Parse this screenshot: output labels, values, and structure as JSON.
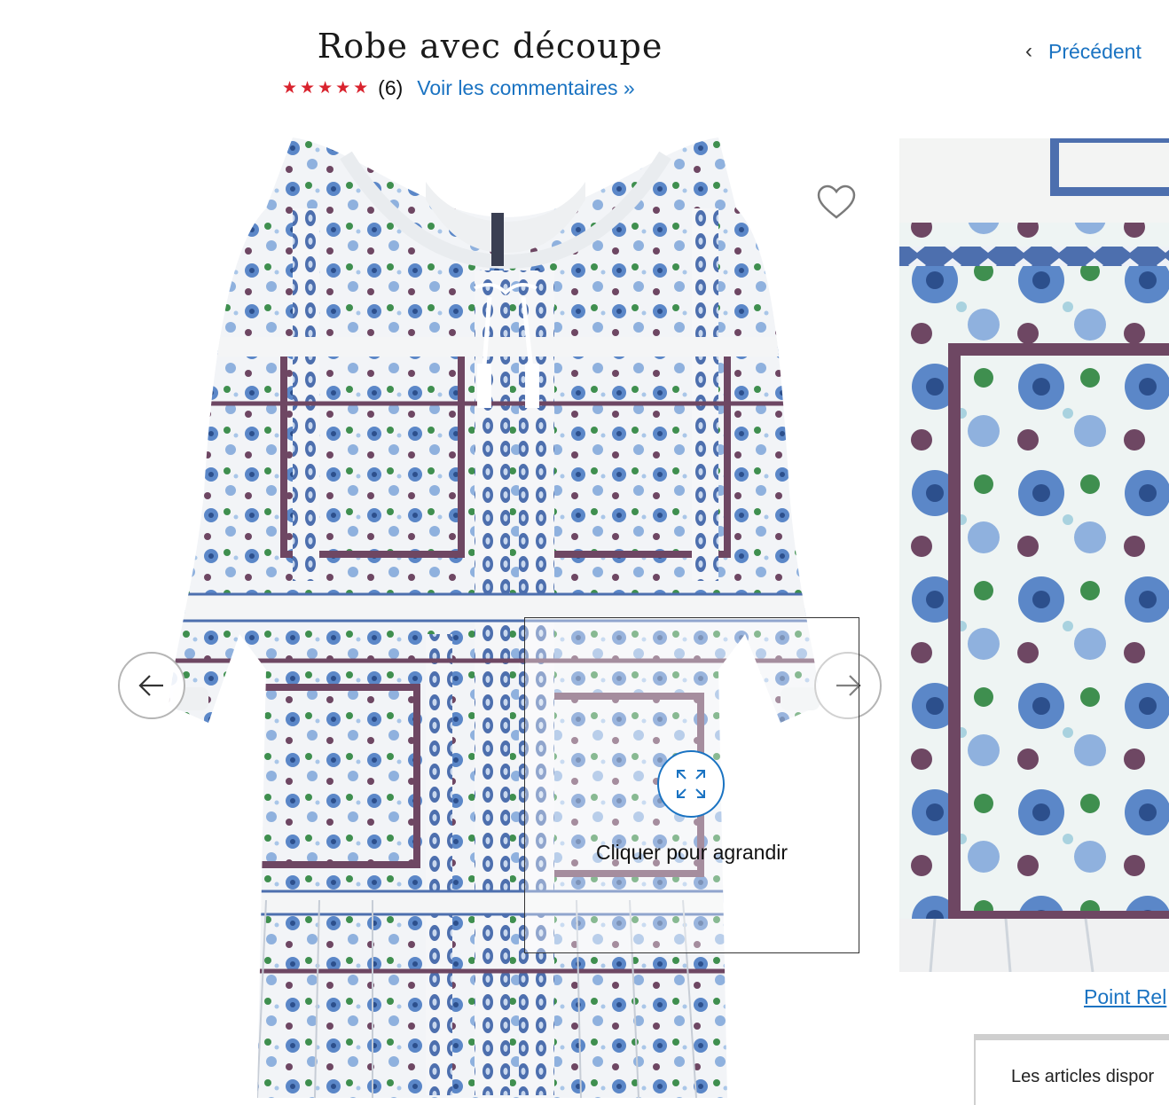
{
  "product": {
    "title": "Robe avec découpe",
    "stars": "★★★★★",
    "review_count": "(6)",
    "reviews_link": "Voir les commentaires »"
  },
  "nav": {
    "previous_label": "Précédent",
    "previous_icon": "chevron-left-icon"
  },
  "gallery": {
    "zoom_label": "Cliquer pour agrandir",
    "favorite_icon": "heart-icon",
    "prev_icon": "arrow-left-icon",
    "next_icon": "arrow-right-icon",
    "zoom_icon": "expand-icon"
  },
  "side": {
    "pickup_link": "Point Rel",
    "stock_text": "Les articles dispor"
  },
  "colors": {
    "accent": "#1a73c2",
    "stars": "#d9232e",
    "print_blue": "#4d7fc4",
    "print_purple": "#6e4763",
    "print_green": "#3f8f4f"
  }
}
